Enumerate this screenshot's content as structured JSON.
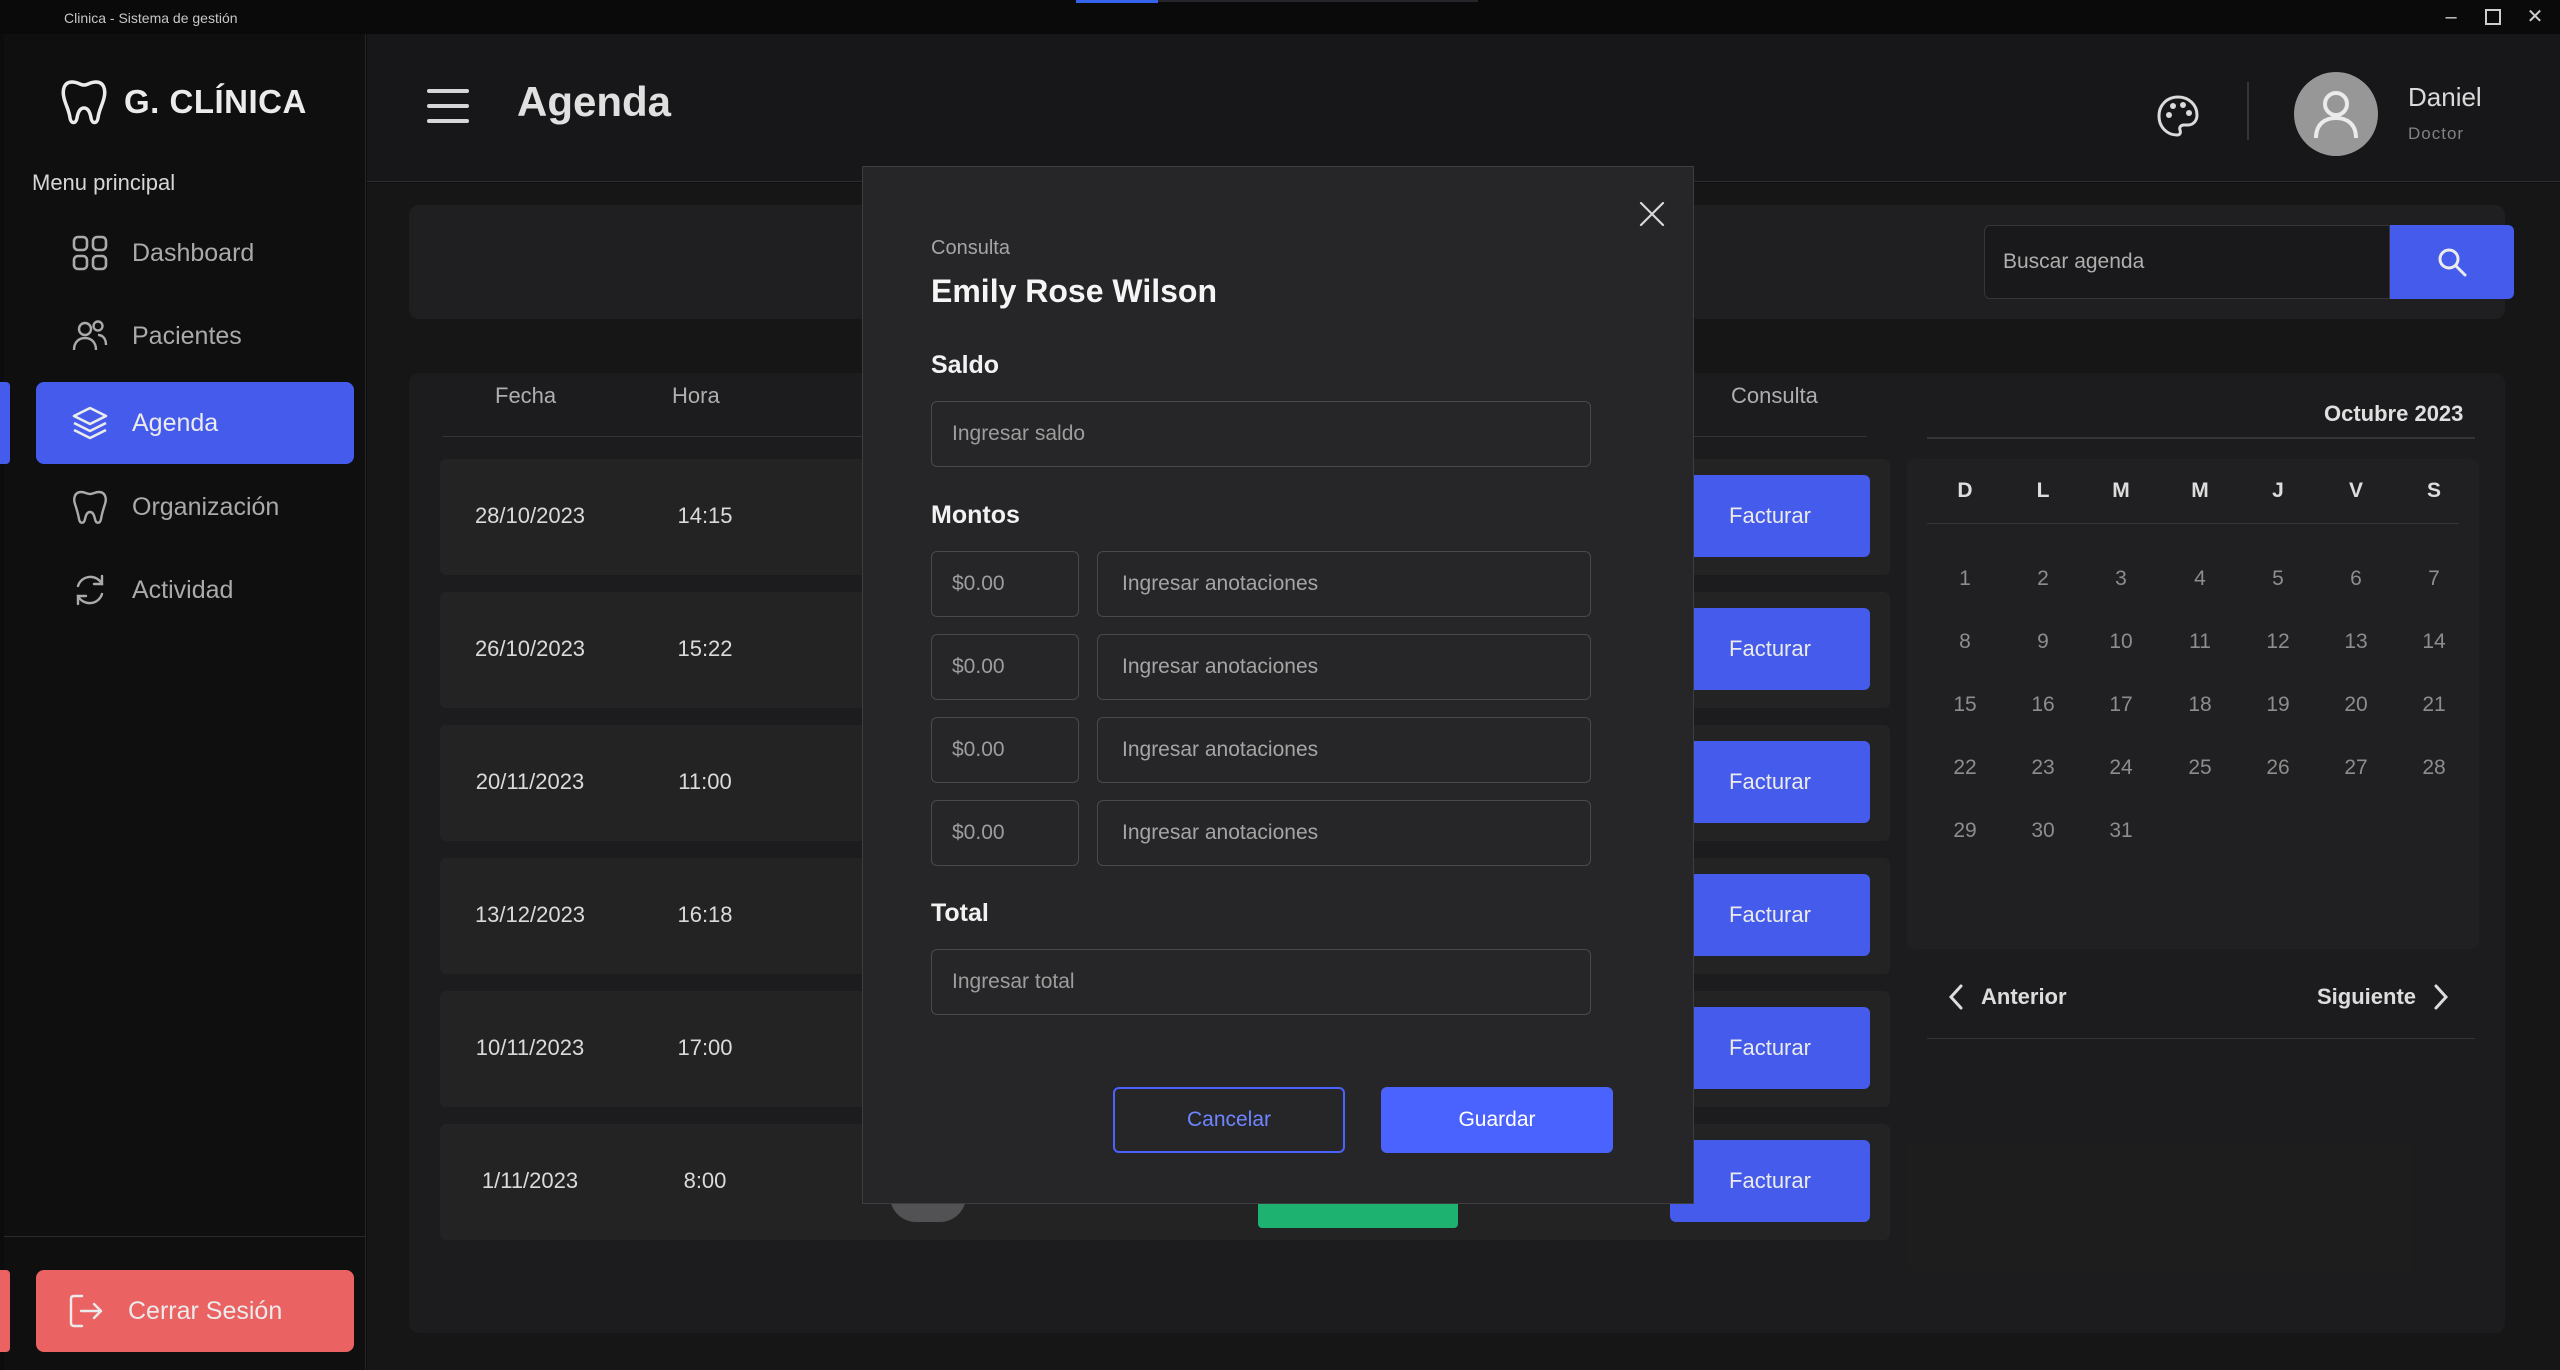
{
  "window": {
    "title": "Clinica - Sistema de gestión"
  },
  "brand": {
    "name": "G. CLÍNICA"
  },
  "sidebar": {
    "menu_title": "Menu principal",
    "items": [
      {
        "label": "Dashboard",
        "icon": "grid-icon"
      },
      {
        "label": "Pacientes",
        "icon": "users-icon"
      },
      {
        "label": "Agenda",
        "icon": "layers-icon",
        "active": true
      },
      {
        "label": "Organización",
        "icon": "tooth-icon"
      },
      {
        "label": "Actividad",
        "icon": "refresh-icon"
      }
    ],
    "logout_label": "Cerrar Sesión"
  },
  "header": {
    "title": "Agenda",
    "user": {
      "name": "Daniel",
      "role": "Doctor"
    }
  },
  "search": {
    "placeholder": "Buscar agenda"
  },
  "table": {
    "headers": {
      "fecha": "Fecha",
      "hora": "Hora",
      "consulta": "Consulta"
    },
    "rows": [
      {
        "fecha": "28/10/2023",
        "hora": "14:15",
        "action": "Facturar"
      },
      {
        "fecha": "26/10/2023",
        "hora": "15:22",
        "action": "Facturar"
      },
      {
        "fecha": "20/11/2023",
        "hora": "11:00",
        "action": "Facturar"
      },
      {
        "fecha": "13/12/2023",
        "hora": "16:18",
        "action": "Facturar"
      },
      {
        "fecha": "10/11/2023",
        "hora": "17:00",
        "action": "Facturar"
      },
      {
        "fecha": "1/11/2023",
        "hora": "8:00",
        "action": "Facturar"
      }
    ]
  },
  "calendar": {
    "month": "Octubre 2023",
    "weekdays": [
      "D",
      "L",
      "M",
      "M",
      "J",
      "V",
      "S"
    ],
    "days": [
      "1",
      "2",
      "3",
      "4",
      "5",
      "6",
      "7",
      "8",
      "9",
      "10",
      "11",
      "12",
      "13",
      "14",
      "15",
      "16",
      "17",
      "18",
      "19",
      "20",
      "21",
      "22",
      "23",
      "24",
      "25",
      "26",
      "27",
      "28",
      "29",
      "30",
      "31"
    ],
    "prev_label": "Anterior",
    "next_label": "Siguiente"
  },
  "modal": {
    "kind": "Consulta",
    "patient": "Emily Rose Wilson",
    "saldo_label": "Saldo",
    "saldo_placeholder": "Ingresar saldo",
    "montos_label": "Montos",
    "montos": [
      {
        "amount": "$0.00",
        "note_placeholder": "Ingresar anotaciones"
      },
      {
        "amount": "$0.00",
        "note_placeholder": "Ingresar anotaciones"
      },
      {
        "amount": "$0.00",
        "note_placeholder": "Ingresar anotaciones"
      },
      {
        "amount": "$0.00",
        "note_placeholder": "Ingresar anotaciones"
      }
    ],
    "total_label": "Total",
    "total_placeholder": "Ingresar total",
    "cancel_label": "Cancelar",
    "save_label": "Guardar"
  },
  "colors": {
    "accent": "#4a63ff",
    "danger": "#ff6b6b",
    "success": "#21c27a",
    "background": "#181819"
  }
}
